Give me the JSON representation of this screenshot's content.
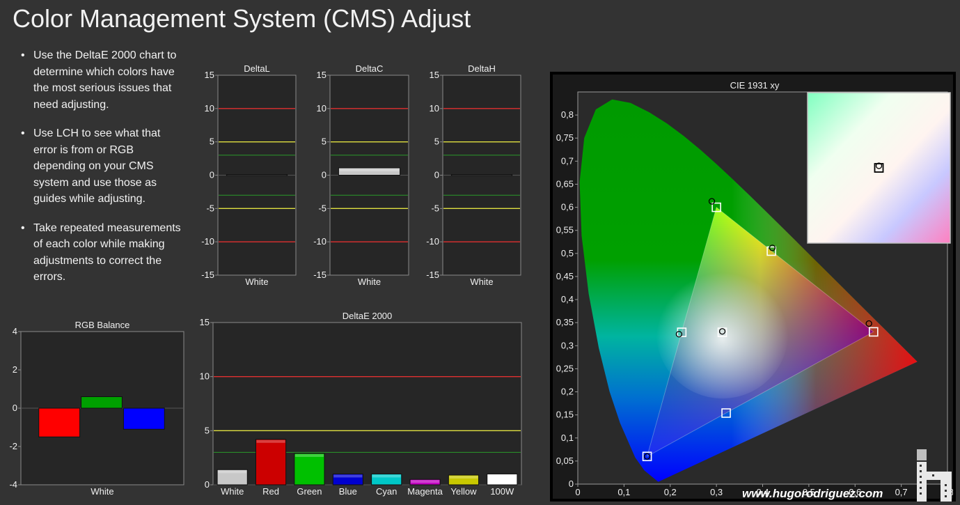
{
  "page": {
    "title": "Color Management System (CMS) Adjust",
    "bullets": [
      "Use the DeltaE 2000 chart to determine which colors have the most serious issues that need adjusting.",
      "Use LCH to see what that error is from or RGB depending on your CMS system and use those as guides while adjusting.",
      "Take repeated measurements of each color while making adjustments to correct the errors."
    ],
    "watermark": "www.hugorodriguez.com"
  },
  "colors": {
    "background": "#333333",
    "panel": "#262626",
    "red_line": "#e03030",
    "yellow_line": "#e0e040",
    "green_line": "#2a9a2a"
  },
  "chart_data": [
    {
      "id": "deltaL",
      "type": "bar",
      "title": "DeltaL",
      "categories": [
        "White"
      ],
      "values": [
        0.1
      ],
      "ylim": [
        -15,
        15
      ],
      "yticks": [
        "15",
        "10",
        "5",
        "0",
        "-5",
        "-10",
        "-15"
      ],
      "bar_colors": [
        "#1a1a1a"
      ],
      "reference_lines": [
        10,
        5,
        3,
        -3,
        -5,
        -10
      ]
    },
    {
      "id": "deltaC",
      "type": "bar",
      "title": "DeltaC",
      "categories": [
        "White"
      ],
      "values": [
        1.1
      ],
      "ylim": [
        -15,
        15
      ],
      "yticks": [
        "15",
        "10",
        "5",
        "0",
        "-5",
        "-10",
        "-15"
      ],
      "bar_colors": [
        "#c8c8c8"
      ],
      "reference_lines": [
        10,
        5,
        3,
        -3,
        -5,
        -10
      ]
    },
    {
      "id": "deltaH",
      "type": "bar",
      "title": "DeltaH",
      "categories": [
        "White"
      ],
      "values": [
        0.1
      ],
      "ylim": [
        -15,
        15
      ],
      "yticks": [
        "15",
        "10",
        "5",
        "0",
        "-5",
        "-10",
        "-15"
      ],
      "bar_colors": [
        "#1a1a1a"
      ],
      "reference_lines": [
        10,
        5,
        3,
        -3,
        -5,
        -10
      ]
    },
    {
      "id": "rgb",
      "type": "bar",
      "title": "RGB Balance",
      "categories": [
        "White"
      ],
      "series": [
        {
          "values": [
            -1.5
          ],
          "color": "#ff0000"
        },
        {
          "values": [
            0.6
          ],
          "color": "#00a000"
        },
        {
          "values": [
            -1.1
          ],
          "color": "#0000ff"
        }
      ],
      "ylim": [
        -4,
        4
      ],
      "yticks": [
        "4",
        "2",
        "0",
        "-2",
        "-4"
      ]
    },
    {
      "id": "deltaE",
      "type": "bar",
      "title": "DeltaE 2000",
      "categories": [
        "White",
        "Red",
        "Green",
        "Blue",
        "Cyan",
        "Magenta",
        "Yellow",
        "100W"
      ],
      "values": [
        1.4,
        4.2,
        2.9,
        1.0,
        1.0,
        0.5,
        0.9,
        1.0
      ],
      "bar_colors": [
        "#c8c8c8",
        "#cc0000",
        "#00c000",
        "#0000d0",
        "#00c8c8",
        "#c000c0",
        "#c8c800",
        "#ffffff"
      ],
      "ylim": [
        0,
        15
      ],
      "yticks": [
        "15",
        "10",
        "5",
        "0"
      ],
      "reference_lines": [
        10,
        5,
        3
      ]
    },
    {
      "id": "cie",
      "type": "scatter",
      "title": "CIE 1931 xy",
      "xlim": [
        0,
        0.8
      ],
      "ylim": [
        0,
        0.85
      ],
      "xticks": [
        "0",
        "0,1",
        "0,2",
        "0,3",
        "0,4",
        "0,5",
        "0,6",
        "0,7",
        "0,8"
      ],
      "yticks": [
        "0",
        "0,05",
        "0,1",
        "0,15",
        "0,2",
        "0,25",
        "0,3",
        "0,35",
        "0,4",
        "0,45",
        "0,5",
        "0,55",
        "0,6",
        "0,65",
        "0,7",
        "0,75",
        "0,8"
      ],
      "targets": [
        {
          "name": "red",
          "x": 0.64,
          "y": 0.33
        },
        {
          "name": "green",
          "x": 0.3,
          "y": 0.6
        },
        {
          "name": "blue",
          "x": 0.15,
          "y": 0.06
        },
        {
          "name": "cyan",
          "x": 0.225,
          "y": 0.329
        },
        {
          "name": "magenta",
          "x": 0.321,
          "y": 0.154
        },
        {
          "name": "yellow",
          "x": 0.419,
          "y": 0.505
        },
        {
          "name": "white",
          "x": 0.3127,
          "y": 0.329
        }
      ],
      "measured": [
        {
          "name": "red",
          "x": 0.63,
          "y": 0.348
        },
        {
          "name": "green",
          "x": 0.29,
          "y": 0.613
        },
        {
          "name": "cyan",
          "x": 0.219,
          "y": 0.325
        },
        {
          "name": "yellow",
          "x": 0.421,
          "y": 0.512
        },
        {
          "name": "white",
          "x": 0.3127,
          "y": 0.331
        },
        {
          "name": "blue",
          "x": 0.15,
          "y": 0.06
        }
      ],
      "inset_measured": {
        "name": "white"
      }
    }
  ]
}
